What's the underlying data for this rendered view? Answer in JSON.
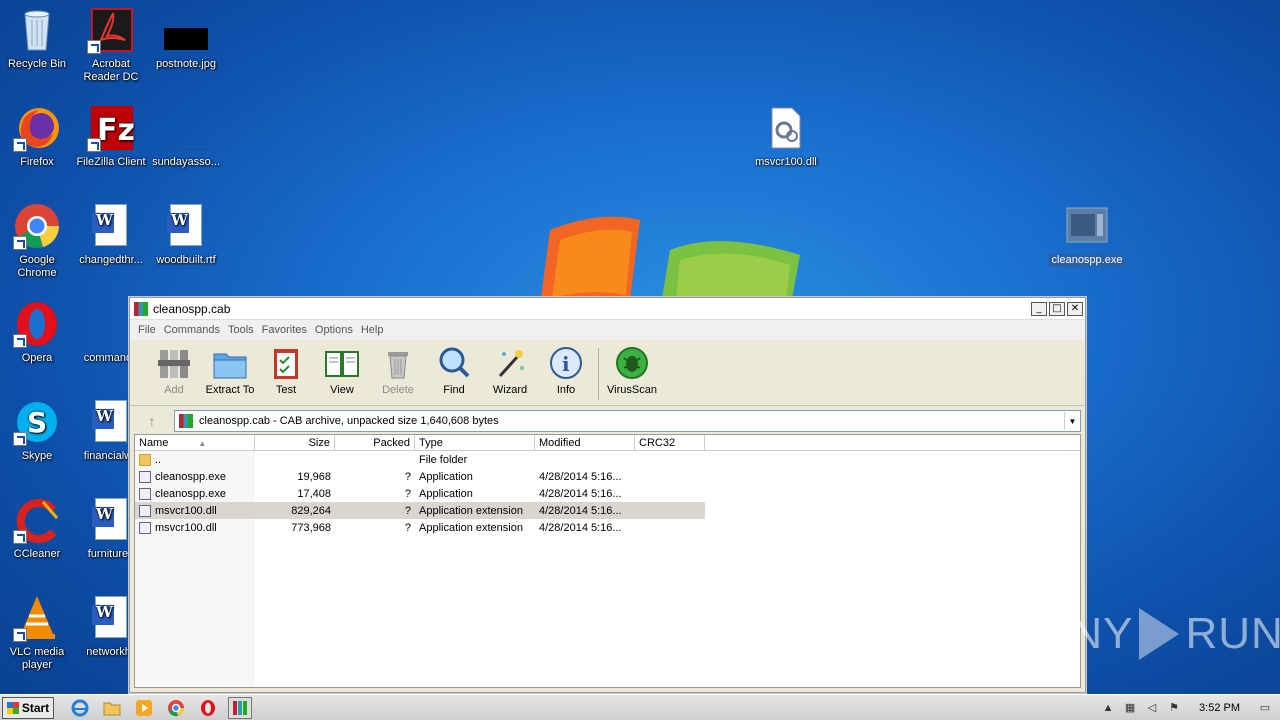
{
  "desktop": {
    "icons": [
      {
        "label": "Recycle Bin",
        "icon": "recycle-bin-icon"
      },
      {
        "label": "Acrobat Reader DC",
        "icon": "acrobat-icon"
      },
      {
        "label": "postnote.jpg",
        "icon": "image-file-icon"
      },
      {
        "label": "Firefox",
        "icon": "firefox-icon"
      },
      {
        "label": "FileZilla Client",
        "icon": "filezilla-icon"
      },
      {
        "label": "sundayasso...",
        "icon": "blank-file-icon"
      },
      {
        "label": "msvcr100.dll",
        "icon": "dll-file-icon"
      },
      {
        "label": "Google Chrome",
        "icon": "chrome-icon"
      },
      {
        "label": "changedthr...",
        "icon": "word-doc-icon"
      },
      {
        "label": "woodbuilt.rtf",
        "icon": "word-doc-icon"
      },
      {
        "label": "cleanospp.exe",
        "icon": "exe-file-icon"
      },
      {
        "label": "Opera",
        "icon": "opera-icon"
      },
      {
        "label": "commando",
        "icon": "blank-file-icon"
      },
      {
        "label": "Skype",
        "icon": "skype-icon"
      },
      {
        "label": "financialwe",
        "icon": "word-doc-icon"
      },
      {
        "label": "CCleaner",
        "icon": "ccleaner-icon"
      },
      {
        "label": "furniturea",
        "icon": "word-doc-icon"
      },
      {
        "label": "VLC media player",
        "icon": "vlc-icon"
      },
      {
        "label": "networkhil",
        "icon": "word-doc-icon"
      }
    ]
  },
  "window": {
    "title": "cleanospp.cab",
    "menu": [
      "File",
      "Commands",
      "Tools",
      "Favorites",
      "Options",
      "Help"
    ],
    "toolbar": [
      {
        "label": "Add",
        "icon": "add-archive-icon",
        "disabled": true
      },
      {
        "label": "Extract To",
        "icon": "extract-folder-icon",
        "disabled": false
      },
      {
        "label": "Test",
        "icon": "test-clipboard-icon",
        "disabled": false
      },
      {
        "label": "View",
        "icon": "view-book-icon",
        "disabled": false
      },
      {
        "label": "Delete",
        "icon": "trash-icon",
        "disabled": true
      },
      {
        "label": "Find",
        "icon": "magnifier-icon",
        "disabled": false
      },
      {
        "label": "Wizard",
        "icon": "wand-icon",
        "disabled": false
      },
      {
        "label": "Info",
        "icon": "info-icon",
        "disabled": false
      },
      {
        "label": "VirusScan",
        "icon": "bug-scan-icon",
        "disabled": false
      }
    ],
    "address": "cleanospp.cab - CAB archive, unpacked size 1,640,608 bytes",
    "columns": {
      "name": "Name",
      "size": "Size",
      "packed": "Packed",
      "type": "Type",
      "modified": "Modified",
      "crc": "CRC32"
    },
    "files": [
      {
        "name": "..",
        "size": "",
        "packed": "",
        "type": "File folder",
        "modified": "",
        "kind": "folder"
      },
      {
        "name": "cleanospp.exe",
        "size": "19,968",
        "packed": "?",
        "type": "Application",
        "modified": "4/28/2014 5:16...",
        "kind": "app"
      },
      {
        "name": "cleanospp.exe",
        "size": "17,408",
        "packed": "?",
        "type": "Application",
        "modified": "4/28/2014 5:16...",
        "kind": "app"
      },
      {
        "name": "msvcr100.dll",
        "size": "829,264",
        "packed": "?",
        "type": "Application extension",
        "modified": "4/28/2014 5:16...",
        "kind": "dll",
        "selected": true
      },
      {
        "name": "msvcr100.dll",
        "size": "773,968",
        "packed": "?",
        "type": "Application extension",
        "modified": "4/28/2014 5:16...",
        "kind": "dll"
      }
    ]
  },
  "taskbar": {
    "start_label": "Start",
    "pinned": [
      "ie-icon",
      "explorer-icon",
      "media-player-icon",
      "chrome-icon",
      "opera-icon",
      "winrar-icon"
    ],
    "clock": "3:52 PM"
  },
  "watermark": {
    "text_left": "ANY",
    "text_right": "RUN"
  }
}
